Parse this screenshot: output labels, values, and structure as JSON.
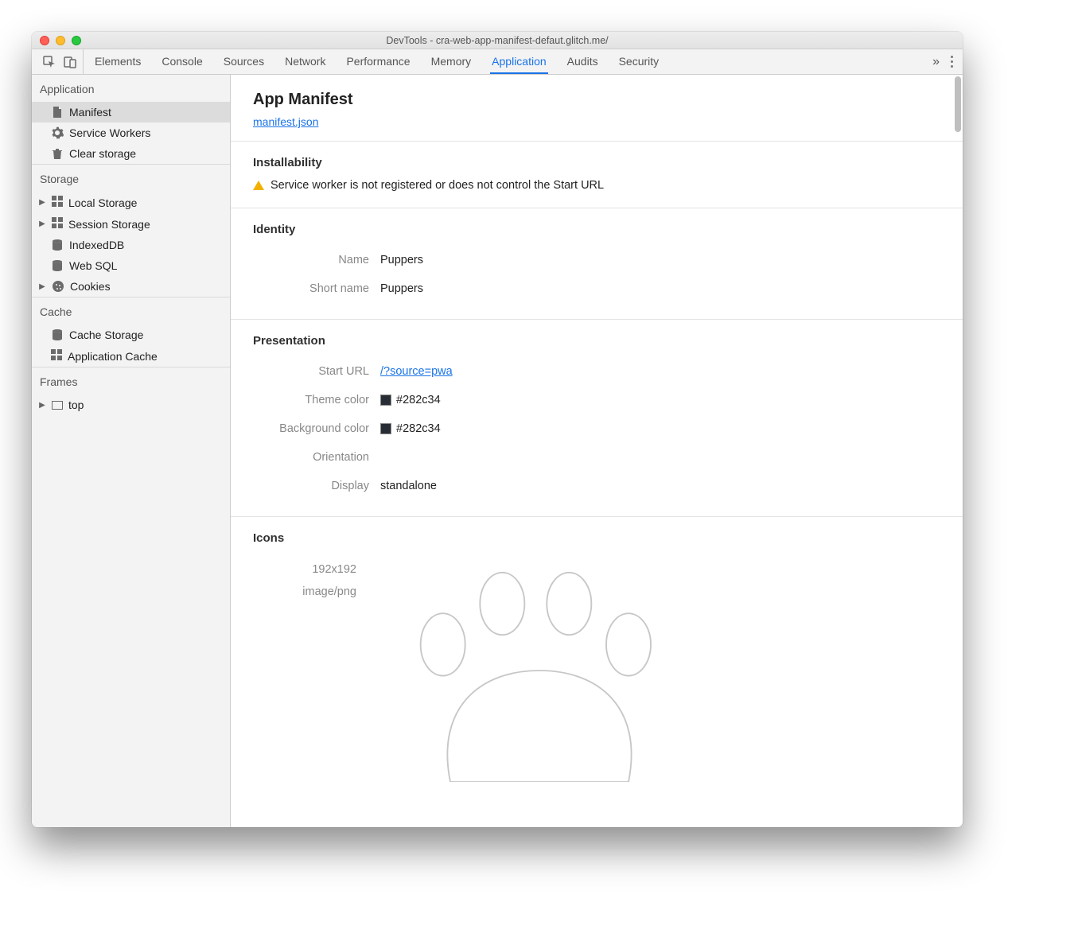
{
  "titlebar": {
    "title": "DevTools - cra-web-app-manifest-defaut.glitch.me/"
  },
  "tabs": [
    "Elements",
    "Console",
    "Sources",
    "Network",
    "Performance",
    "Memory",
    "Application",
    "Audits",
    "Security"
  ],
  "active_tab": "Application",
  "sidebar": {
    "groups": [
      {
        "title": "Application",
        "items": [
          {
            "label": "Manifest",
            "icon": "file",
            "selected": true
          },
          {
            "label": "Service Workers",
            "icon": "gear"
          },
          {
            "label": "Clear storage",
            "icon": "clear"
          }
        ]
      },
      {
        "title": "Storage",
        "items": [
          {
            "label": "Local Storage",
            "icon": "grid",
            "expandable": true
          },
          {
            "label": "Session Storage",
            "icon": "grid",
            "expandable": true
          },
          {
            "label": "IndexedDB",
            "icon": "db"
          },
          {
            "label": "Web SQL",
            "icon": "db"
          },
          {
            "label": "Cookies",
            "icon": "cookie",
            "expandable": true
          }
        ]
      },
      {
        "title": "Cache",
        "items": [
          {
            "label": "Cache Storage",
            "icon": "db"
          },
          {
            "label": "Application Cache",
            "icon": "grid"
          }
        ]
      },
      {
        "title": "Frames",
        "items": [
          {
            "label": "top",
            "icon": "frame",
            "expandable": true
          }
        ]
      }
    ]
  },
  "manifest": {
    "heading": "App Manifest",
    "link_text": "manifest.json",
    "installability": {
      "heading": "Installability",
      "warning": "Service worker is not registered or does not control the Start URL"
    },
    "identity": {
      "heading": "Identity",
      "name_label": "Name",
      "name_value": "Puppers",
      "short_label": "Short name",
      "short_value": "Puppers"
    },
    "presentation": {
      "heading": "Presentation",
      "start_label": "Start URL",
      "start_value": "/?source=pwa",
      "theme_label": "Theme color",
      "theme_value": "#282c34",
      "bg_label": "Background color",
      "bg_value": "#282c34",
      "orientation_label": "Orientation",
      "orientation_value": "",
      "display_label": "Display",
      "display_value": "standalone"
    },
    "icons": {
      "heading": "Icons",
      "size": "192x192",
      "mime": "image/png"
    }
  }
}
